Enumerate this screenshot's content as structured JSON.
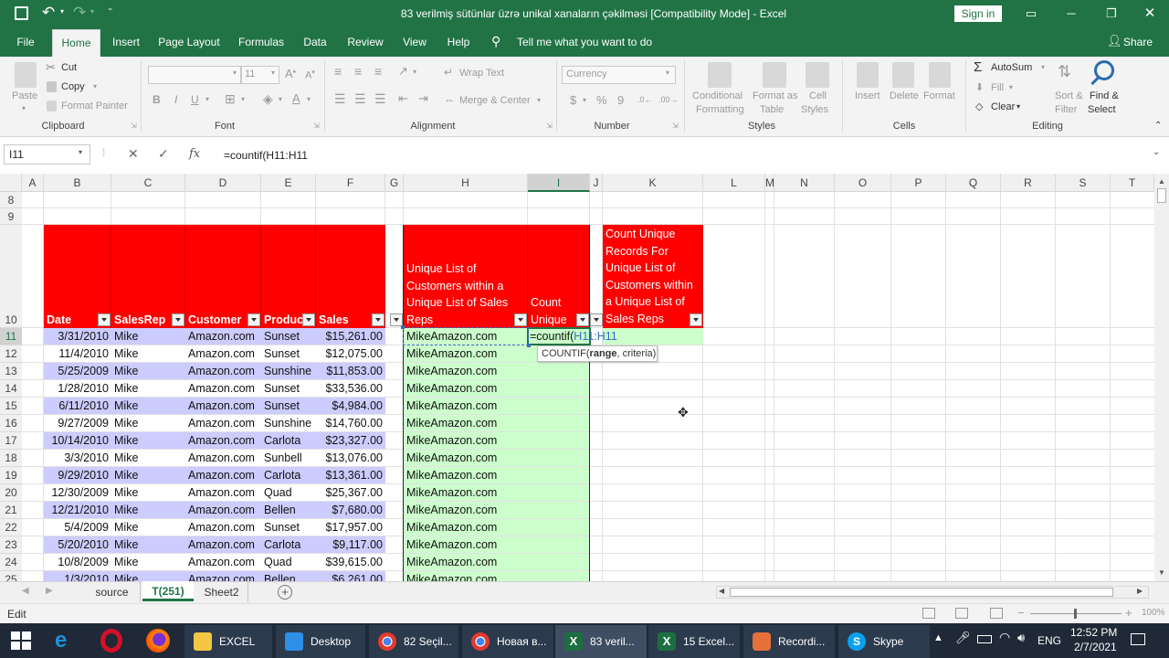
{
  "window": {
    "title": "83 verilmiş sütünlar üzrə unikal xanaların çəkilməsi  [Compatibility Mode]  -  Excel",
    "sign_in": "Sign in"
  },
  "tabs": [
    "File",
    "Home",
    "Insert",
    "Page Layout",
    "Formulas",
    "Data",
    "Review",
    "View",
    "Help"
  ],
  "tell_me": "Tell me what you want to do",
  "share": "Share",
  "ribbon": {
    "clipboard": {
      "paste": "Paste",
      "cut": "Cut",
      "copy": "Copy",
      "format_painter": "Format Painter",
      "label": "Clipboard"
    },
    "font": {
      "size": "11",
      "label": "Font",
      "bold": "B",
      "italic": "I",
      "underline": "U"
    },
    "alignment": {
      "wrap": "Wrap Text",
      "merge": "Merge & Center",
      "label": "Alignment"
    },
    "number": {
      "format": "Currency",
      "dollar": "$",
      "percent": "%",
      "comma": "9",
      "label": "Number"
    },
    "styles": {
      "cond1": "Conditional",
      "cond2": "Formatting",
      "table1": "Format as",
      "table2": "Table",
      "cell1": "Cell",
      "cell2": "Styles",
      "label": "Styles"
    },
    "cells": {
      "insert": "Insert",
      "delete": "Delete",
      "format": "Format",
      "label": "Cells"
    },
    "editing": {
      "autosum": "AutoSum",
      "fill": "Fill",
      "clear": "Clear",
      "sort1": "Sort &",
      "sort2": "Filter",
      "find1": "Find &",
      "find2": "Select",
      "label": "Editing"
    }
  },
  "formula_bar": {
    "name_box": "I11",
    "fx": "fx",
    "formula": "=countif(H11:H11"
  },
  "columns": [
    "A",
    "B",
    "C",
    "D",
    "E",
    "F",
    "G",
    "H",
    "I",
    "J",
    "K",
    "L",
    "M",
    "N",
    "O",
    "P",
    "Q",
    "R",
    "S",
    "T"
  ],
  "rows": [
    "8",
    "9",
    "10",
    "11",
    "12",
    "13",
    "14",
    "15",
    "16",
    "17",
    "18",
    "19",
    "20",
    "21",
    "22",
    "23",
    "24",
    "25"
  ],
  "headers": {
    "date": "Date",
    "salesrep": "SalesRep",
    "customer": "Customer",
    "product": "Produc",
    "sales": "Sales",
    "unique_list": "Unique List of Customers within a Unique List of Sales Reps",
    "count_unique": "Count Unique",
    "count_records": "Count Unique Records For Unique List of Customers within a Unique List of Sales Reps"
  },
  "data": [
    {
      "date": "3/31/2010",
      "rep": "Mike",
      "cust": "Amazon.com",
      "prod": "Sunset",
      "sales": "$15,261.00",
      "h": "MikeAmazon.com"
    },
    {
      "date": "11/4/2010",
      "rep": "Mike",
      "cust": "Amazon.com",
      "prod": "Sunset",
      "sales": "$12,075.00",
      "h": "MikeAmazon.com"
    },
    {
      "date": "5/25/2009",
      "rep": "Mike",
      "cust": "Amazon.com",
      "prod": "Sunshine",
      "sales": "$11,853.00",
      "h": "MikeAmazon.com"
    },
    {
      "date": "1/28/2010",
      "rep": "Mike",
      "cust": "Amazon.com",
      "prod": "Sunset",
      "sales": "$33,536.00",
      "h": "MikeAmazon.com"
    },
    {
      "date": "6/11/2010",
      "rep": "Mike",
      "cust": "Amazon.com",
      "prod": "Sunset",
      "sales": "$4,984.00",
      "h": "MikeAmazon.com"
    },
    {
      "date": "9/27/2009",
      "rep": "Mike",
      "cust": "Amazon.com",
      "prod": "Sunshine",
      "sales": "$14,760.00",
      "h": "MikeAmazon.com"
    },
    {
      "date": "10/14/2010",
      "rep": "Mike",
      "cust": "Amazon.com",
      "prod": "Carlota",
      "sales": "$23,327.00",
      "h": "MikeAmazon.com"
    },
    {
      "date": "3/3/2010",
      "rep": "Mike",
      "cust": "Amazon.com",
      "prod": "Sunbell",
      "sales": "$13,076.00",
      "h": "MikeAmazon.com"
    },
    {
      "date": "9/29/2010",
      "rep": "Mike",
      "cust": "Amazon.com",
      "prod": "Carlota",
      "sales": "$13,361.00",
      "h": "MikeAmazon.com"
    },
    {
      "date": "12/30/2009",
      "rep": "Mike",
      "cust": "Amazon.com",
      "prod": "Quad",
      "sales": "$25,367.00",
      "h": "MikeAmazon.com"
    },
    {
      "date": "12/21/2010",
      "rep": "Mike",
      "cust": "Amazon.com",
      "prod": "Bellen",
      "sales": "$7,680.00",
      "h": "MikeAmazon.com"
    },
    {
      "date": "5/4/2009",
      "rep": "Mike",
      "cust": "Amazon.com",
      "prod": "Sunset",
      "sales": "$17,957.00",
      "h": "MikeAmazon.com"
    },
    {
      "date": "5/20/2010",
      "rep": "Mike",
      "cust": "Amazon.com",
      "prod": "Carlota",
      "sales": "$9,117.00",
      "h": "MikeAmazon.com"
    },
    {
      "date": "10/8/2009",
      "rep": "Mike",
      "cust": "Amazon.com",
      "prod": "Quad",
      "sales": "$39,615.00",
      "h": "MikeAmazon.com"
    },
    {
      "date": "1/3/2010",
      "rep": "Mike",
      "cust": "Amazon.com",
      "prod": "Bellen",
      "sales": "$6,261.00",
      "h": "MikeAmazon.com"
    }
  ],
  "edit_cell": {
    "text": "=countif(",
    "ref": "H11:H11",
    "tooltip_fn": "COUNTIF(",
    "tooltip_arg": "range",
    ", criteria)": ", criteria)"
  },
  "sheets": [
    "source",
    "T(251)",
    "Sheet2"
  ],
  "status": {
    "mode": "Edit",
    "zoom": "100%"
  },
  "taskbar": {
    "items": [
      "EXCEL",
      "Desktop",
      "82 Seçil...",
      "Новая в...",
      "83 veril...",
      "15 Excel...",
      "Recordi...",
      "Skype"
    ],
    "lang": "ENG",
    "time": "12:52 PM",
    "date": "2/7/2021"
  },
  "colors": {
    "excel_green": "#217346",
    "header_red": "#ff0000",
    "band": "#ccccff",
    "green_fill": "#ccffcc"
  }
}
